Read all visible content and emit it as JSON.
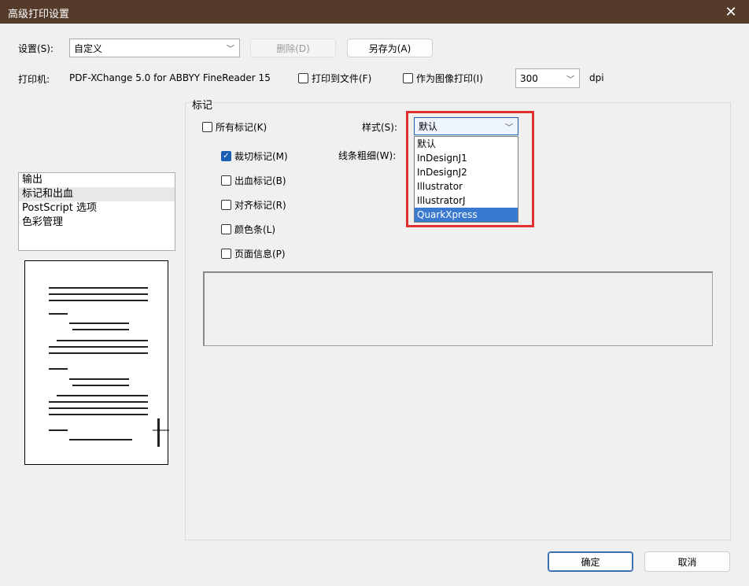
{
  "window": {
    "title": "高级打印设置"
  },
  "settings": {
    "label": "设置(S):",
    "value": "自定义",
    "delete_label": "删除(D)",
    "saveas_label": "另存为(A)"
  },
  "printer": {
    "label": "打印机:",
    "name": "PDF-XChange 5.0 for ABBYY FineReader 15",
    "print_to_file": "打印到文件(F)",
    "print_as_image": "作为图像打印(I)",
    "dpi_value": "300",
    "dpi_unit": "dpi"
  },
  "nav": {
    "items": [
      "输出",
      "标记和出血",
      "PostScript 选项",
      "色彩管理"
    ],
    "selected": "标记和出血"
  },
  "marks": {
    "group_title": "标记",
    "all_marks": "所有标记(K)",
    "crop_marks": "裁切标记(M)",
    "bleed_marks": "出血标记(B)",
    "registration_marks": "对齐标记(R)",
    "color_bars": "颜色条(L)",
    "page_info": "页面信息(P)",
    "style_label": "样式(S):",
    "style_value": "默认",
    "weight_label": "线条粗细(W):",
    "style_options": [
      "默认",
      "InDesignJ1",
      "InDesignJ2",
      "Illustrator",
      "IllustratorJ",
      "QuarkXpress"
    ],
    "highlighted_option": "QuarkXpress"
  },
  "footer": {
    "ok": "确定",
    "cancel": "取消"
  },
  "colors": {
    "titlebar": "#553b2a",
    "accent": "#1a5fb4",
    "highlight": "#3a79d0",
    "annotation": "#e03030"
  }
}
